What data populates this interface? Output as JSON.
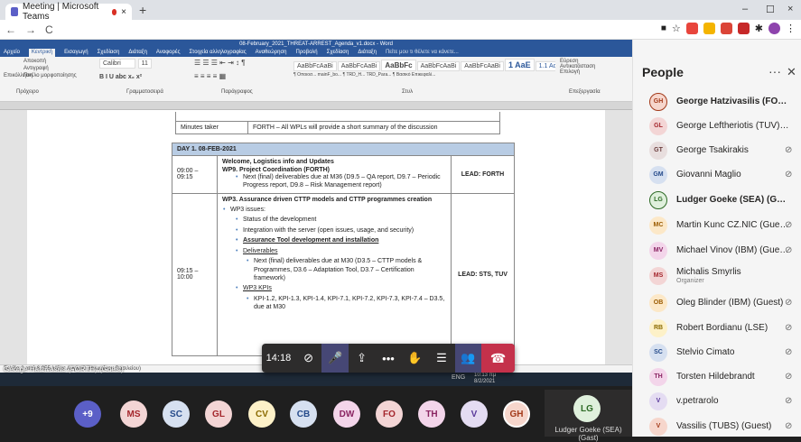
{
  "browser": {
    "tab_title": "Meeting | Microsoft Teams",
    "new_tab": "+",
    "close": "×",
    "min": "–",
    "max": "☐",
    "win_close": "×",
    "back": "←",
    "forward": "→",
    "reload": "C"
  },
  "word": {
    "title": "08-February_2021_THREAT-ARREST_Agenda_v1.docx - Word",
    "tabs": [
      "Αρχείο",
      "Κεντρική",
      "Εισαγωγή",
      "Σχεδίαση",
      "Διάταξη",
      "Αναφορές",
      "Στοιχεία αλληλογραφίας",
      "Αναθεώρηση",
      "Προβολή",
      "Σχεδίαση",
      "Διάταξη"
    ],
    "tell": "Πείτε μου τι θέλετε να κάνετε...",
    "font": "Calibri",
    "size": "11",
    "styles": [
      "AaBbFcAaBi",
      "AaBbFcAaBi",
      "AaBbFc",
      "AaBbFcAaBi",
      "AaBbFcAaBi",
      "1 AaE",
      "1.1 Ac",
      "1.1.1 /",
      "1.1.1.1 /"
    ],
    "style_names": [
      "¶ Οποιοσ...",
      "mainF_bo...",
      "¶ TRD_H...",
      "TRD_Para...",
      "¶ Βασικό",
      "Επικεφαλί...",
      "Επικεφαλί...",
      "Επικεφαλί...",
      "Επικεφαλί..."
    ],
    "groups": [
      "Πρόχειρο",
      "Γραμματοσειρά",
      "Παράγραφος",
      "Στυλ",
      "Επεξεργασία"
    ],
    "edit": [
      "Εύρεση",
      "Αντικατάσταση",
      "Επιλογή"
    ],
    "paste": "Επικόλληση",
    "cut": "Αποκοπή",
    "copy": "Αντιγραφή",
    "painter": "Πινέλο μορφοποίησης",
    "status": "Σελίδα 2 από 6   955 λέξεις   Αγγλικά (Ηνωμένου Βασιλείου)"
  },
  "doc": {
    "minutes_label": "Minutes taker",
    "minutes_value": "FORTH – All WPLs will provide a short summary of the discussion",
    "day": "DAY 1. 08-FEB-2021",
    "row1_time": "09:00 – 09:15",
    "row1_title": "Welcome, Logistics info and Updates",
    "row1_wp": "WP9. Project Coordination (FORTH)",
    "row1_bullet": "Next (final) deliverables due at M36 (D9.5 – QA report, D9.7 – Periodic Progress report, D9.8 – Risk Management report)",
    "row1_lead": "LEAD: FORTH",
    "row2_time": "09:15 – 10:00",
    "row2_title": "WP3. Assurance driven CTTP models and CTTP programmes creation",
    "row2_issues": "WP3 issues:",
    "row2_items": [
      "Status of the development",
      "Integration with the server (open issues, usage, and security)",
      "Assurance Tool development and installation",
      "Deliverables"
    ],
    "row2_deliv": "Next (final) deliverables due at M30 (D3.5 – CTTP models & Programmes, D3.6 – Adaptation Tool, D3.7 – Certification framework)",
    "row2_kpis": "WP3 KPIs",
    "row2_kpi_text": "KPI-1.2, KPI-1.3, KPI-1.4, KPI-7.1, KPI-7.2, KPI-7.3, KPI-7.4 – D3.5, due at M30",
    "row2_lead": "LEAD: STS, TUV"
  },
  "presenter": "George Hatzivasilis (FORTH) (Guest)",
  "controls": {
    "timer": "14:18"
  },
  "bottom": {
    "more": "+9",
    "avatars": [
      "MS",
      "SC",
      "GL",
      "CV",
      "CB",
      "DW",
      "FO",
      "TH",
      "V",
      "GH"
    ],
    "self_initials": "LG",
    "self_name": "Ludger Goeke (SEA) (Gast)"
  },
  "taskbar": {
    "lang": "ENG",
    "time": "10:13 πμ",
    "date": "8/2/2021"
  },
  "people": {
    "title": "People",
    "list": [
      {
        "initials": "GH",
        "name": "George Hatzivasilis (FORTH) (G...",
        "bold": true,
        "color": "#f6d6cc",
        "fg": "#a33a1a"
      },
      {
        "initials": "GL",
        "name": "George Leftheriotis (TUV) (Guest)",
        "bold": false,
        "color": "#f3d5d5",
        "fg": "#a4262c"
      },
      {
        "initials": "GT",
        "name": "George Tsakirakis",
        "bold": false,
        "color": "#e8dede",
        "fg": "#6b3d3d",
        "mic": true
      },
      {
        "initials": "GM",
        "name": "Giovanni Maglio",
        "bold": false,
        "color": "#d6e0f0",
        "fg": "#254a8a",
        "mic": true
      },
      {
        "initials": "LG",
        "name": "Ludger Goeke (SEA) (Gast)",
        "bold": true,
        "color": "#dff0dc",
        "fg": "#2d6a25"
      },
      {
        "initials": "MC",
        "name": "Martin Kunc CZ.NIC (Guest)",
        "bold": false,
        "color": "#fce8c8",
        "fg": "#9a5a00",
        "mic": true
      },
      {
        "initials": "MV",
        "name": "Michael Vinov (IBM) (Guest)",
        "bold": false,
        "color": "#f3d5ea",
        "fg": "#8a2462",
        "mic": true
      },
      {
        "initials": "MS",
        "name": "Michalis Smyrlis",
        "sub": "Organizer",
        "bold": false,
        "color": "#f3d5d5",
        "fg": "#a4262c"
      },
      {
        "initials": "OB",
        "name": "Oleg Blinder (IBM) (Guest)",
        "bold": false,
        "color": "#fce8c8",
        "fg": "#9a5a00",
        "mic": true
      },
      {
        "initials": "RB",
        "name": "Robert Bordianu (LSE)",
        "bold": false,
        "color": "#fdf1c8",
        "fg": "#8a6a00",
        "mic": true
      },
      {
        "initials": "SC",
        "name": "Stelvio Cimato",
        "bold": false,
        "color": "#d6e0f0",
        "fg": "#254a8a",
        "mic": true
      },
      {
        "initials": "TH",
        "name": "Torsten Hildebrandt",
        "bold": false,
        "color": "#f3d5ea",
        "fg": "#8a2462",
        "mic": true
      },
      {
        "initials": "V",
        "name": "v.petrarolo",
        "bold": false,
        "color": "#e4dcf2",
        "fg": "#5a3a9a",
        "mic": true
      },
      {
        "initials": "V",
        "name": "Vassilis (TUBS) (Guest)",
        "bold": false,
        "color": "#f6d6cc",
        "fg": "#a33a1a",
        "mic": true
      }
    ]
  }
}
